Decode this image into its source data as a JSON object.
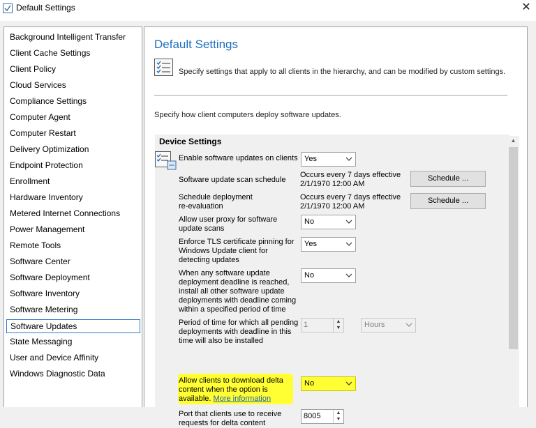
{
  "window": {
    "title": "Default Settings",
    "close_glyph": "✕"
  },
  "sidebar": {
    "items": [
      {
        "label": "Background Intelligent Transfer"
      },
      {
        "label": "Client Cache Settings"
      },
      {
        "label": "Client Policy"
      },
      {
        "label": "Cloud Services"
      },
      {
        "label": "Compliance Settings"
      },
      {
        "label": "Computer Agent"
      },
      {
        "label": "Computer Restart"
      },
      {
        "label": "Delivery Optimization"
      },
      {
        "label": "Endpoint Protection"
      },
      {
        "label": "Enrollment"
      },
      {
        "label": "Hardware Inventory"
      },
      {
        "label": "Metered Internet Connections"
      },
      {
        "label": "Power Management"
      },
      {
        "label": "Remote Tools"
      },
      {
        "label": "Software Center"
      },
      {
        "label": "Software Deployment"
      },
      {
        "label": "Software Inventory"
      },
      {
        "label": "Software Metering"
      },
      {
        "label": "Software Updates",
        "selected": true
      },
      {
        "label": "State Messaging"
      },
      {
        "label": "User and Device Affinity"
      },
      {
        "label": "Windows Diagnostic Data"
      }
    ]
  },
  "main": {
    "title": "Default Settings",
    "description": "Specify settings that apply to all clients in the hierarchy, and can be modified by custom settings.",
    "sub_description": "Specify how client computers deploy software updates.",
    "group_title": "Device Settings",
    "settings": {
      "enable_updates": {
        "label": "Enable software updates on clients",
        "value": "Yes"
      },
      "scan_schedule": {
        "label": "Software update scan schedule",
        "value_line1": "Occurs every 7 days effective",
        "value_line2": "2/1/1970 12:00 AM",
        "button": "Schedule ..."
      },
      "reeval_schedule": {
        "label_line1": "Schedule deployment",
        "label_line2": "re-evaluation",
        "value_line1": "Occurs every 7 days effective",
        "value_line2": "2/1/1970 12:00 AM",
        "button": "Schedule ..."
      },
      "user_proxy": {
        "label_line1": "Allow user proxy for software",
        "label_line2": "update scans",
        "value": "No"
      },
      "tls_pinning": {
        "label_lines": [
          "Enforce TLS certificate pinning for",
          "Windows Update client for",
          "detecting updates"
        ],
        "value": "Yes"
      },
      "deadline_install": {
        "label_lines": [
          "When any software update",
          "deployment deadline is reached,",
          "install all other software update",
          "deployments with deadline coming",
          "within a specified period of time"
        ],
        "value": "No"
      },
      "period": {
        "label_lines": [
          "Period of time for which all pending",
          "deployments with deadline in this",
          "time will also be installed"
        ],
        "value": "1",
        "unit": "Hours"
      },
      "delta_download": {
        "label_lines": [
          "Allow clients to download delta",
          "content when the option is",
          "available."
        ],
        "link": "More information",
        "value": "No"
      },
      "delta_port": {
        "label_lines": [
          "Port that clients use to receive",
          "requests for delta content"
        ],
        "value": "8005"
      }
    }
  },
  "colors": {
    "accent": "#1e6fc0",
    "highlight": "#ffff33",
    "selection_border": "#3377cc"
  },
  "icons": [
    "settings-checklist-icon",
    "close-icon",
    "dropdown-arrow-icon"
  ]
}
